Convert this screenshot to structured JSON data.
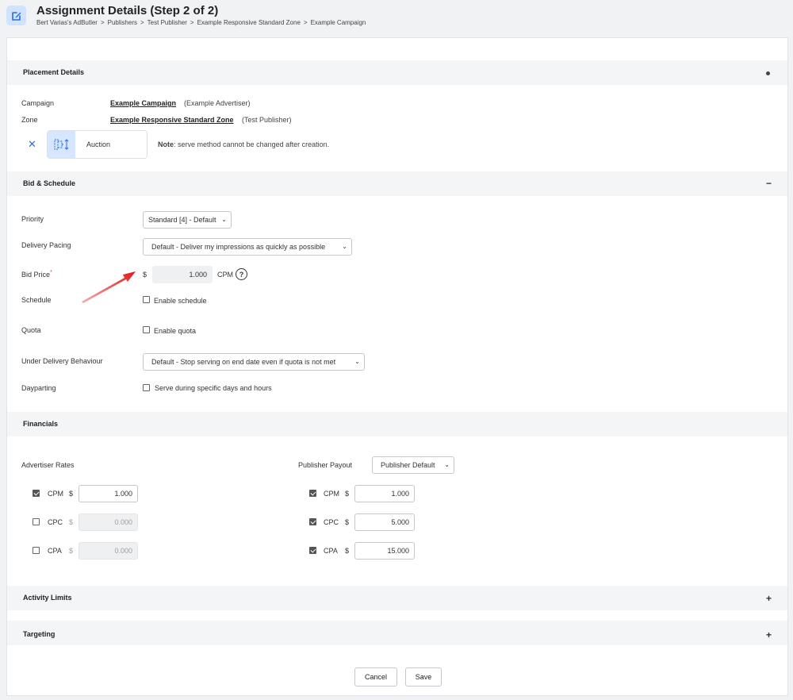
{
  "header": {
    "title": "Assignment Details (Step 2 of 2)",
    "icon": "edit-icon",
    "breadcrumb": [
      "Bert Varias's AdButler",
      "Publishers",
      "Test Publisher",
      "Example Responsive Standard Zone",
      "Example Campaign"
    ],
    "breadcrumb_sep": ">"
  },
  "placement": {
    "title": "Placement Details",
    "campaign_label": "Campaign",
    "campaign_name": "Example Campaign",
    "campaign_owner": "(Example Advertiser)",
    "zone_label": "Zone",
    "zone_name": "Example Responsive Standard Zone",
    "zone_owner": "(Test Publisher)",
    "close_glyph": "✕",
    "serve_method": "Auction",
    "note_bold": "Note",
    "note_text": ": serve method cannot be changed after creation."
  },
  "bid": {
    "title": "Bid & Schedule",
    "toggle": "−",
    "priority_label": "Priority",
    "priority_value": "Standard [4] - Default",
    "pacing_label": "Delivery Pacing",
    "pacing_value": "Default - Deliver my impressions as quickly as possible",
    "bid_label": "Bid Price",
    "bid_required": "*",
    "bid_currency": "$",
    "bid_value": "1.000",
    "bid_unit": "CPM",
    "help_glyph": "?",
    "schedule_label": "Schedule",
    "schedule_option": "Enable schedule",
    "quota_label": "Quota",
    "quota_option": "Enable quota",
    "under_label": "Under Delivery Behaviour",
    "under_value": "Default - Stop serving on end date even if quota is not met",
    "daypart_label": "Dayparting",
    "daypart_option": "Serve during specific days and hours"
  },
  "financials": {
    "title": "Financials",
    "advertiser_label": "Advertiser Rates",
    "publisher_label": "Publisher Payout",
    "publisher_mode": "Publisher Default",
    "currency": "$",
    "advertiser_rows": [
      {
        "name": "CPM",
        "value": "1.000",
        "checked": true
      },
      {
        "name": "CPC",
        "value": "0.000",
        "checked": false
      },
      {
        "name": "CPA",
        "value": "0.000",
        "checked": false
      }
    ],
    "publisher_rows": [
      {
        "name": "CPM",
        "value": "1.000",
        "checked": true
      },
      {
        "name": "CPC",
        "value": "5.000",
        "checked": true
      },
      {
        "name": "CPA",
        "value": "15.000",
        "checked": true
      }
    ]
  },
  "activity": {
    "title": "Activity Limits",
    "toggle": "+"
  },
  "targeting": {
    "title": "Targeting",
    "toggle": "+"
  },
  "actions": {
    "cancel": "Cancel",
    "save": "Save"
  },
  "colors": {
    "accent": "#2a6fd6",
    "arrow": "#e02020",
    "section_bg": "#f4f5f6"
  }
}
